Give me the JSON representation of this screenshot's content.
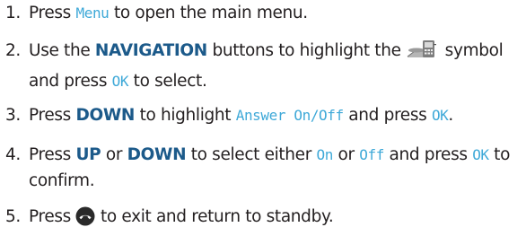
{
  "steps": [
    {
      "number": "1.",
      "parts": [
        "Press ",
        "Menu",
        " to open the main menu."
      ]
    },
    {
      "number": "2.",
      "parts": [
        "Use the ",
        "NAVIGATION",
        " buttons to highlight the ",
        " symbol and press ",
        "OK",
        " to select."
      ]
    },
    {
      "number": "3.",
      "parts": [
        "Press ",
        "DOWN",
        " to highlight ",
        "Answer On/Off",
        " and press ",
        "OK",
        "."
      ]
    },
    {
      "number": "4.",
      "parts": [
        "Press ",
        "UP",
        " or ",
        "DOWN",
        " to select either ",
        "On",
        " or ",
        "Off",
        " and press ",
        "OK",
        " to confirm."
      ]
    },
    {
      "number": "5.",
      "parts": [
        "Press ",
        " to exit and return to standby."
      ]
    }
  ],
  "icons": {
    "menu_symbol": "phone-settings-icon",
    "end_key": "end-call-key-icon"
  },
  "colors": {
    "text": "#231f20",
    "keyword": "#1c5a8a",
    "lcd_text": "#3fa9d8",
    "icon_gray": "#8a8a8a",
    "key_dark": "#2a2a2a"
  }
}
